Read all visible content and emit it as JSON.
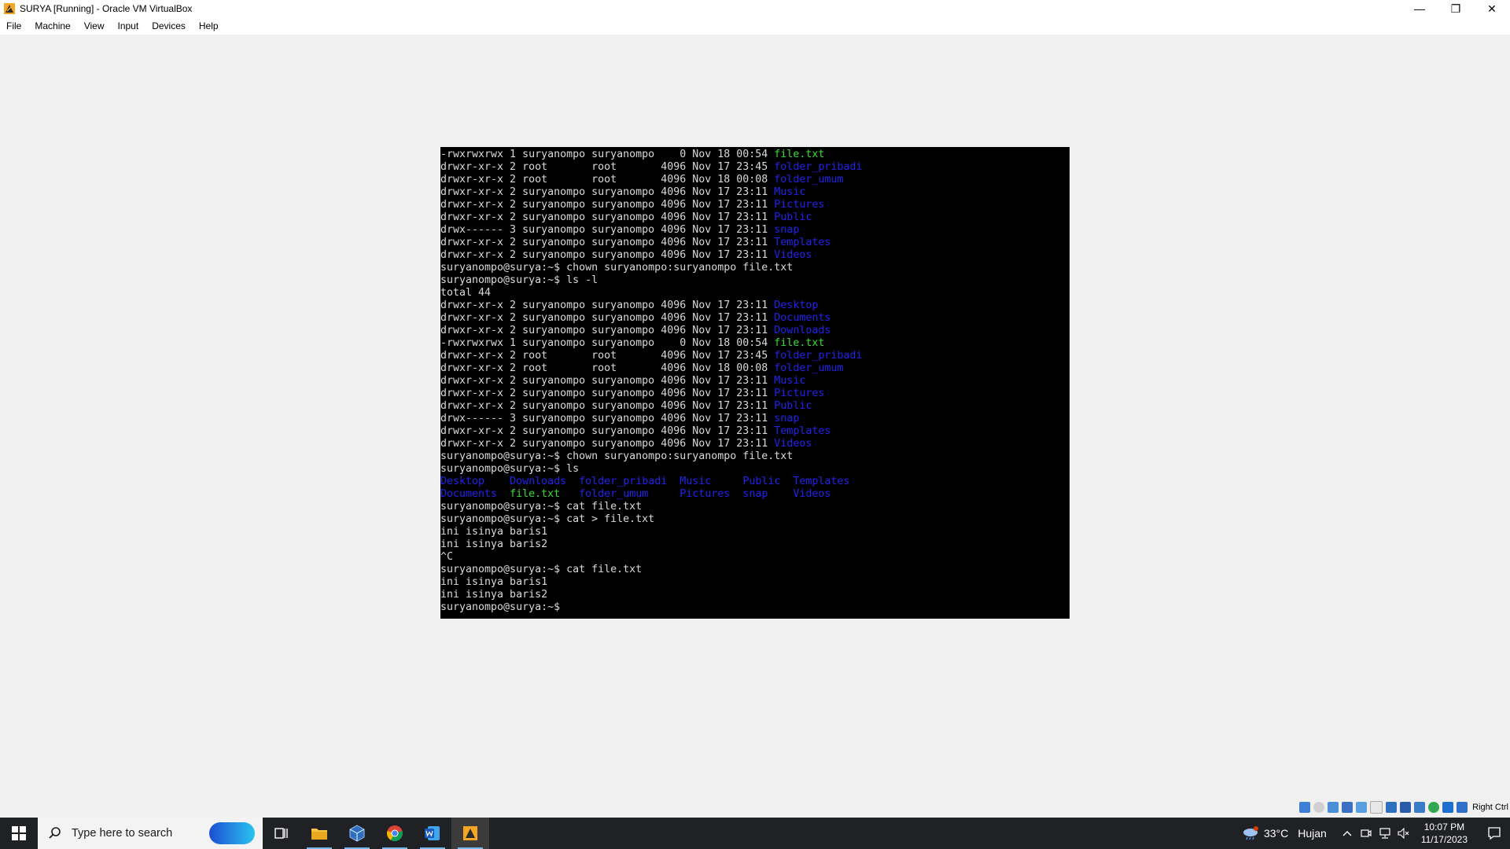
{
  "window": {
    "title": "SURYA [Running] - Oracle VM VirtualBox",
    "minimize_glyph": "—",
    "restore_glyph": "❐",
    "close_glyph": "✕"
  },
  "menu": [
    "File",
    "Machine",
    "View",
    "Input",
    "Devices",
    "Help"
  ],
  "colors": {
    "file": "#33dd33",
    "dir": "#2222ee",
    "text": "#d8d8d8",
    "background": "#000000"
  },
  "terminal": {
    "lines": [
      [
        {
          "t": "-rwxrwxrwx 1 suryanompo suryanompo    0 Nov 18 00:54 ",
          "c": "plain"
        },
        {
          "t": "file.txt",
          "c": "file"
        }
      ],
      [
        {
          "t": "drwxr-xr-x 2 root       root       4096 Nov 17 23:45 ",
          "c": "plain"
        },
        {
          "t": "folder_pribadi",
          "c": "dir"
        }
      ],
      [
        {
          "t": "drwxr-xr-x 2 root       root       4096 Nov 18 00:08 ",
          "c": "plain"
        },
        {
          "t": "folder_umum",
          "c": "dir"
        }
      ],
      [
        {
          "t": "drwxr-xr-x 2 suryanompo suryanompo 4096 Nov 17 23:11 ",
          "c": "plain"
        },
        {
          "t": "Music",
          "c": "dir"
        }
      ],
      [
        {
          "t": "drwxr-xr-x 2 suryanompo suryanompo 4096 Nov 17 23:11 ",
          "c": "plain"
        },
        {
          "t": "Pictures",
          "c": "dir"
        }
      ],
      [
        {
          "t": "drwxr-xr-x 2 suryanompo suryanompo 4096 Nov 17 23:11 ",
          "c": "plain"
        },
        {
          "t": "Public",
          "c": "dir"
        }
      ],
      [
        {
          "t": "drwx------ 3 suryanompo suryanompo 4096 Nov 17 23:11 ",
          "c": "plain"
        },
        {
          "t": "snap",
          "c": "dir"
        }
      ],
      [
        {
          "t": "drwxr-xr-x 2 suryanompo suryanompo 4096 Nov 17 23:11 ",
          "c": "plain"
        },
        {
          "t": "Templates",
          "c": "dir"
        }
      ],
      [
        {
          "t": "drwxr-xr-x 2 suryanompo suryanompo 4096 Nov 17 23:11 ",
          "c": "plain"
        },
        {
          "t": "Videos",
          "c": "dir"
        }
      ],
      [
        {
          "t": "suryanompo@surya:~$ chown suryanompo:suryanompo file.txt",
          "c": "plain"
        }
      ],
      [
        {
          "t": "suryanompo@surya:~$ ls -l",
          "c": "plain"
        }
      ],
      [
        {
          "t": "total 44",
          "c": "plain"
        }
      ],
      [
        {
          "t": "drwxr-xr-x 2 suryanompo suryanompo 4096 Nov 17 23:11 ",
          "c": "plain"
        },
        {
          "t": "Desktop",
          "c": "dir"
        }
      ],
      [
        {
          "t": "drwxr-xr-x 2 suryanompo suryanompo 4096 Nov 17 23:11 ",
          "c": "plain"
        },
        {
          "t": "Documents",
          "c": "dir"
        }
      ],
      [
        {
          "t": "drwxr-xr-x 2 suryanompo suryanompo 4096 Nov 17 23:11 ",
          "c": "plain"
        },
        {
          "t": "Downloads",
          "c": "dir"
        }
      ],
      [
        {
          "t": "-rwxrwxrwx 1 suryanompo suryanompo    0 Nov 18 00:54 ",
          "c": "plain"
        },
        {
          "t": "file.txt",
          "c": "file"
        }
      ],
      [
        {
          "t": "drwxr-xr-x 2 root       root       4096 Nov 17 23:45 ",
          "c": "plain"
        },
        {
          "t": "folder_pribadi",
          "c": "dir"
        }
      ],
      [
        {
          "t": "drwxr-xr-x 2 root       root       4096 Nov 18 00:08 ",
          "c": "plain"
        },
        {
          "t": "folder_umum",
          "c": "dir"
        }
      ],
      [
        {
          "t": "drwxr-xr-x 2 suryanompo suryanompo 4096 Nov 17 23:11 ",
          "c": "plain"
        },
        {
          "t": "Music",
          "c": "dir"
        }
      ],
      [
        {
          "t": "drwxr-xr-x 2 suryanompo suryanompo 4096 Nov 17 23:11 ",
          "c": "plain"
        },
        {
          "t": "Pictures",
          "c": "dir"
        }
      ],
      [
        {
          "t": "drwxr-xr-x 2 suryanompo suryanompo 4096 Nov 17 23:11 ",
          "c": "plain"
        },
        {
          "t": "Public",
          "c": "dir"
        }
      ],
      [
        {
          "t": "drwx------ 3 suryanompo suryanompo 4096 Nov 17 23:11 ",
          "c": "plain"
        },
        {
          "t": "snap",
          "c": "dir"
        }
      ],
      [
        {
          "t": "drwxr-xr-x 2 suryanompo suryanompo 4096 Nov 17 23:11 ",
          "c": "plain"
        },
        {
          "t": "Templates",
          "c": "dir"
        }
      ],
      [
        {
          "t": "drwxr-xr-x 2 suryanompo suryanompo 4096 Nov 17 23:11 ",
          "c": "plain"
        },
        {
          "t": "Videos",
          "c": "dir"
        }
      ],
      [
        {
          "t": "suryanompo@surya:~$ chown suryanompo:suryanompo file.txt",
          "c": "plain"
        }
      ],
      [
        {
          "t": "suryanompo@surya:~$ ls",
          "c": "plain"
        }
      ],
      [
        {
          "t": "Desktop",
          "c": "dir"
        },
        {
          "t": "    ",
          "c": "plain"
        },
        {
          "t": "Downloads",
          "c": "dir"
        },
        {
          "t": "  ",
          "c": "plain"
        },
        {
          "t": "folder_pribadi",
          "c": "dir"
        },
        {
          "t": "  ",
          "c": "plain"
        },
        {
          "t": "Music",
          "c": "dir"
        },
        {
          "t": "     ",
          "c": "plain"
        },
        {
          "t": "Public",
          "c": "dir"
        },
        {
          "t": "  ",
          "c": "plain"
        },
        {
          "t": "Templates",
          "c": "dir"
        }
      ],
      [
        {
          "t": "Documents",
          "c": "dir"
        },
        {
          "t": "  ",
          "c": "plain"
        },
        {
          "t": "file.txt",
          "c": "file"
        },
        {
          "t": "   ",
          "c": "plain"
        },
        {
          "t": "folder_umum",
          "c": "dir"
        },
        {
          "t": "     ",
          "c": "plain"
        },
        {
          "t": "Pictures",
          "c": "dir"
        },
        {
          "t": "  ",
          "c": "plain"
        },
        {
          "t": "snap",
          "c": "dir"
        },
        {
          "t": "    ",
          "c": "plain"
        },
        {
          "t": "Videos",
          "c": "dir"
        }
      ],
      [
        {
          "t": "suryanompo@surya:~$ cat file.txt",
          "c": "plain"
        }
      ],
      [
        {
          "t": "suryanompo@surya:~$ cat > file.txt",
          "c": "plain"
        }
      ],
      [
        {
          "t": "ini isinya baris1",
          "c": "plain"
        }
      ],
      [
        {
          "t": "ini isinya baris2",
          "c": "plain"
        }
      ],
      [
        {
          "t": "^C",
          "c": "plain"
        }
      ],
      [
        {
          "t": "suryanompo@surya:~$ cat file.txt",
          "c": "plain"
        }
      ],
      [
        {
          "t": "ini isinya baris1",
          "c": "plain"
        }
      ],
      [
        {
          "t": "ini isinya baris2",
          "c": "plain"
        }
      ],
      [
        {
          "t": "suryanompo@surya:~$ ",
          "c": "plain"
        }
      ]
    ]
  },
  "vm_status": {
    "icons": [
      "hard-disk-icon",
      "optical-disk-icon",
      "audio-icon",
      "network-icon",
      "usb-icon",
      "shared-folder-icon",
      "display-icon",
      "video-capture-icon",
      "cpu-icon",
      "guest-additions-icon",
      "mouse-integration-icon",
      "keyboard-icon"
    ],
    "host_key": "Right Ctrl"
  },
  "taskbar": {
    "search_placeholder": "Type here to search",
    "apps": [
      "task-view",
      "file-explorer",
      "virtualbox",
      "chrome",
      "word",
      "virtualbox-vm"
    ],
    "weather_temp": "33°C",
    "weather_desc": "Hujan",
    "time": "10:07 PM",
    "date": "11/17/2023"
  }
}
